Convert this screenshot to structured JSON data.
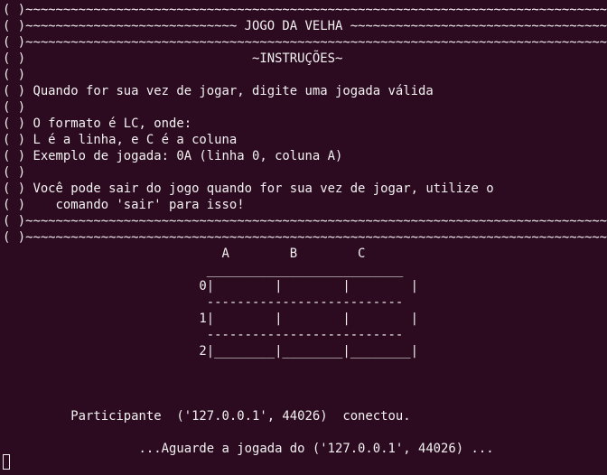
{
  "terminal": {
    "lines": [
      "( )~~~~~~~~~~~~~~~~~~~~~~~~~~~~~~~~~~~~~~~~~~~~~~~~~~~~~~~~~~~~~~~~~~~~~~~~~~~~~~~~~~~~~~|",
      "( )~~~~~~~~~~~~~~~~~~~~~~~~~~~~ JOGO DA VELHA ~~~~~~~~~~~~~~~~~~~~~~~~~~~~~~~~~~~~~~~~~~|",
      "( )~~~~~~~~~~~~~~~~~~~~~~~~~~~~~~~~~~~~~~~~~~~~~~~~~~~~~~~~~~~~~~~~~~~~~~~~~~~~~~~~~~~~~~|",
      "( )                              ~INSTRUÇÕES~                                           |",
      "( )                                                                                     |",
      "( ) Quando for sua vez de jogar, digite uma jogada válida                               |",
      "( )                                                                                     |",
      "( ) O formato é LC, onde:                                                              |",
      "( ) L é a linha, e C é a coluna                                                         |",
      "( ) Exemplo de jogada: 0A (linha 0, coluna A)                                          |",
      "( )                                                                                     |",
      "( ) Você pode sair do jogo quando for sua vez de jogar, utilize o                       |",
      "( )    comando 'sair' para isso!                                                        |",
      "( )~~~~~~~~~~~~~~~~~~~~~~~~~~~~~~~~~~~~~~~~~~~~~~~~~~~~~~~~~~~~~~~~~~~~~~~~~~~~~~~~~~~~~~|",
      "( )~~~~~~~~~~~~~~~~~~~~~~~~~~~~~~~~~~~~~~~~~~~~~~~~~~~~~~~~~~~~~~~~~~~~~~~~~~~~~~~~~~~~~~|",
      "                             A        B        C",
      "                           __________________________",
      "                          0|        |        |        |",
      "                           --------------------------",
      "                          1|        |        |        |",
      "                           --------------------------",
      "                          2|________|________|________|",
      "",
      "",
      "",
      "         Participante  ('127.0.0.1', 44026)  conectou.",
      "",
      "                  ...Aguarde a jogada do ('127.0.0.1', 44026) ..."
    ]
  }
}
